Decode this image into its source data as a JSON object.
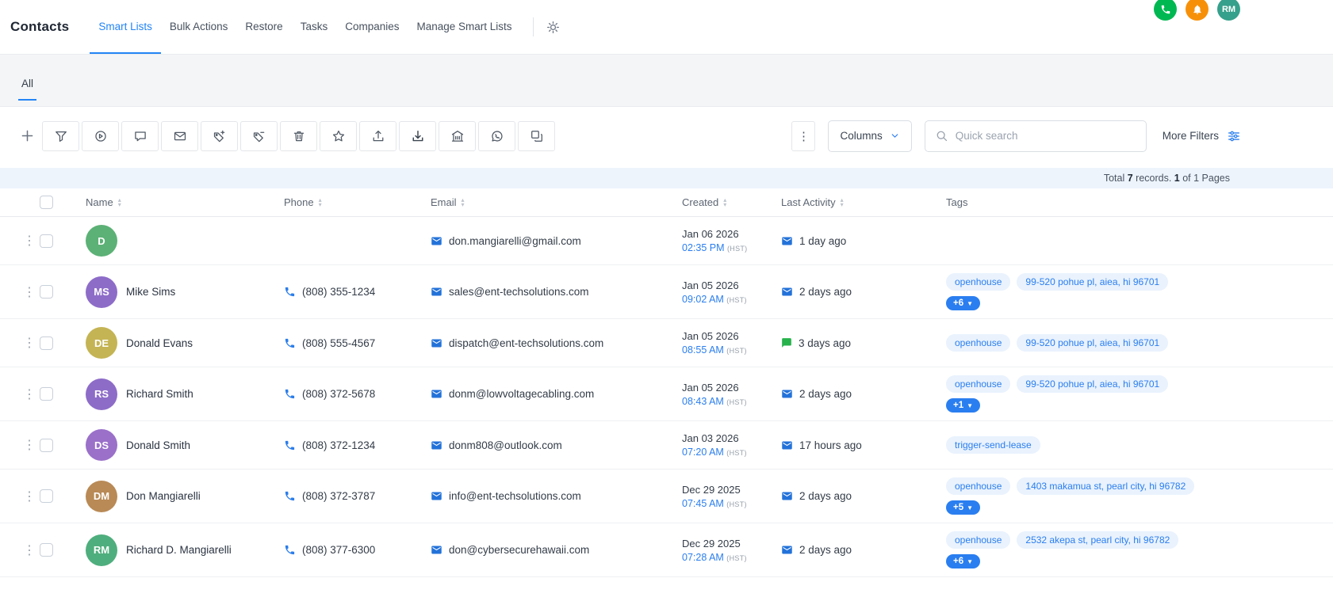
{
  "topbar": {
    "phone_color": "#00b852",
    "bell_color": "#f79009",
    "avatar_text": "RM",
    "avatar_color": "#35a08b"
  },
  "header": {
    "title": "Contacts",
    "tabs": [
      {
        "label": "Smart Lists",
        "active": true
      },
      {
        "label": "Bulk Actions",
        "active": false
      },
      {
        "label": "Restore",
        "active": false
      },
      {
        "label": "Tasks",
        "active": false
      },
      {
        "label": "Companies",
        "active": false
      },
      {
        "label": "Manage Smart Lists",
        "active": false
      }
    ]
  },
  "subtabs": [
    {
      "label": "All",
      "active": true
    }
  ],
  "toolbar": {
    "buttons": [
      {
        "icon": "add-icon"
      },
      {
        "icon": "filter-funnel-icon"
      },
      {
        "icon": "campaign-icon"
      },
      {
        "icon": "sms-icon"
      },
      {
        "icon": "email-icon"
      },
      {
        "icon": "add-tag-icon"
      },
      {
        "icon": "remove-tag-icon"
      },
      {
        "icon": "delete-icon"
      },
      {
        "icon": "star-icon"
      },
      {
        "icon": "export-icon"
      },
      {
        "icon": "import-icon"
      },
      {
        "icon": "business-icon"
      },
      {
        "icon": "whatsapp-icon"
      },
      {
        "icon": "merge-icon"
      }
    ],
    "columns_button": "Columns",
    "search_placeholder": "Quick search",
    "more_filters": "More Filters"
  },
  "summary": {
    "total_label": "Total",
    "count": "7",
    "records_label": "records.",
    "page": "1",
    "pages_label": "of 1 Pages"
  },
  "table": {
    "columns": [
      {
        "label": "Name",
        "sortable": true
      },
      {
        "label": "Phone",
        "sortable": true
      },
      {
        "label": "Email",
        "sortable": true
      },
      {
        "label": "Created",
        "sortable": true
      },
      {
        "label": "Last Activity",
        "sortable": true
      },
      {
        "label": "Tags",
        "sortable": false
      }
    ],
    "rows": [
      {
        "initials": "D",
        "avatar_color": "#5cb176",
        "name": "",
        "phone": "",
        "email": "don.mangiarelli@gmail.com",
        "created_date": "Jan 06 2026",
        "created_time": "02:35 PM",
        "created_tz": "(HST)",
        "activity": "1 day ago",
        "activity_icon": "email",
        "tags": [],
        "more_count": ""
      },
      {
        "initials": "MS",
        "avatar_color": "#8d6cc8",
        "name": "Mike Sims",
        "phone": "(808) 355-1234",
        "email": "sales@ent-techsolutions.com",
        "created_date": "Jan 05 2026",
        "created_time": "09:02 AM",
        "created_tz": "(HST)",
        "activity": "2 days ago",
        "activity_icon": "email",
        "tags": [
          "openhouse",
          "99-520 pohue pl, aiea, hi 96701"
        ],
        "more_count": "+6"
      },
      {
        "initials": "DE",
        "avatar_color": "#c4b454",
        "name": "Donald Evans",
        "phone": "(808) 555-4567",
        "email": "dispatch@ent-techsolutions.com",
        "created_date": "Jan 05 2026",
        "created_time": "08:55 AM",
        "created_tz": "(HST)",
        "activity": "3 days ago",
        "activity_icon": "chat",
        "tags": [
          "openhouse",
          "99-520 pohue pl, aiea, hi 96701"
        ],
        "more_count": ""
      },
      {
        "initials": "RS",
        "avatar_color": "#8d6cc8",
        "name": "Richard Smith",
        "phone": "(808) 372-5678",
        "email": "donm@lowvoltagecabling.com",
        "created_date": "Jan 05 2026",
        "created_time": "08:43 AM",
        "created_tz": "(HST)",
        "activity": "2 days ago",
        "activity_icon": "email",
        "tags": [
          "openhouse",
          "99-520 pohue pl, aiea, hi 96701"
        ],
        "more_count": "+1"
      },
      {
        "initials": "DS",
        "avatar_color": "#9a70c9",
        "name": "Donald Smith",
        "phone": "(808) 372-1234",
        "email": "donm808@outlook.com",
        "created_date": "Jan 03 2026",
        "created_time": "07:20 AM",
        "created_tz": "(HST)",
        "activity": "17 hours ago",
        "activity_icon": "email",
        "tags": [
          "trigger-send-lease"
        ],
        "more_count": ""
      },
      {
        "initials": "DM",
        "avatar_color": "#b98a56",
        "name": "Don Mangiarelli",
        "phone": "(808) 372-3787",
        "email": "info@ent-techsolutions.com",
        "created_date": "Dec 29 2025",
        "created_time": "07:45 AM",
        "created_tz": "(HST)",
        "activity": "2 days ago",
        "activity_icon": "email",
        "tags": [
          "openhouse",
          "1403 makamua st, pearl city, hi 96782"
        ],
        "more_count": "+5"
      },
      {
        "initials": "RM",
        "avatar_color": "#4fae7d",
        "name": "Richard D. Mangiarelli",
        "phone": "(808) 377-6300",
        "email": "don@cybersecurehawaii.com",
        "created_date": "Dec 29 2025",
        "created_time": "07:28 AM",
        "created_tz": "(HST)",
        "activity": "2 days ago",
        "activity_icon": "email",
        "tags": [
          "openhouse",
          "2532 akepa st, pearl city, hi 96782"
        ],
        "more_count": "+6"
      }
    ]
  },
  "colors": {
    "accent_blue": "#2384f5",
    "tag_bg": "#e9f2fd",
    "tag_text": "#2a7ef0",
    "summary_bg": "#edf4fc",
    "activity_green": "#27b24b"
  }
}
